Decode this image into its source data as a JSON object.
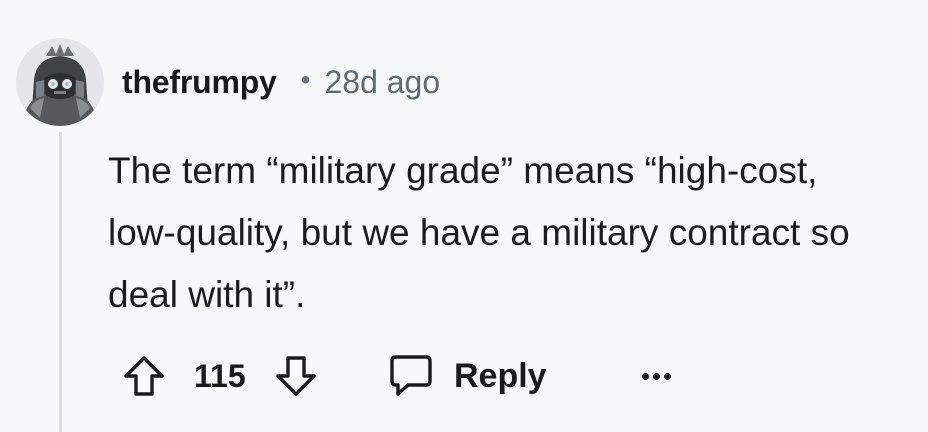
{
  "comment": {
    "author": "thefrumpy",
    "separator": "•",
    "age": "28d ago",
    "text": "The term “military grade” means “high-cost, low-quality, but we have a military contract so deal with it”.",
    "score": "115",
    "reply_label": "Reply"
  },
  "icons": {
    "avatar": "avatar-robot-icon",
    "upvote": "arrow-up-icon",
    "downvote": "arrow-down-icon",
    "reply": "speech-bubble-icon",
    "more": "ellipsis-icon"
  },
  "colors": {
    "background": "#f7f8fa",
    "thread_line": "#d9dee4",
    "text": "#1c1c1c",
    "muted": "#5f6b7a"
  }
}
